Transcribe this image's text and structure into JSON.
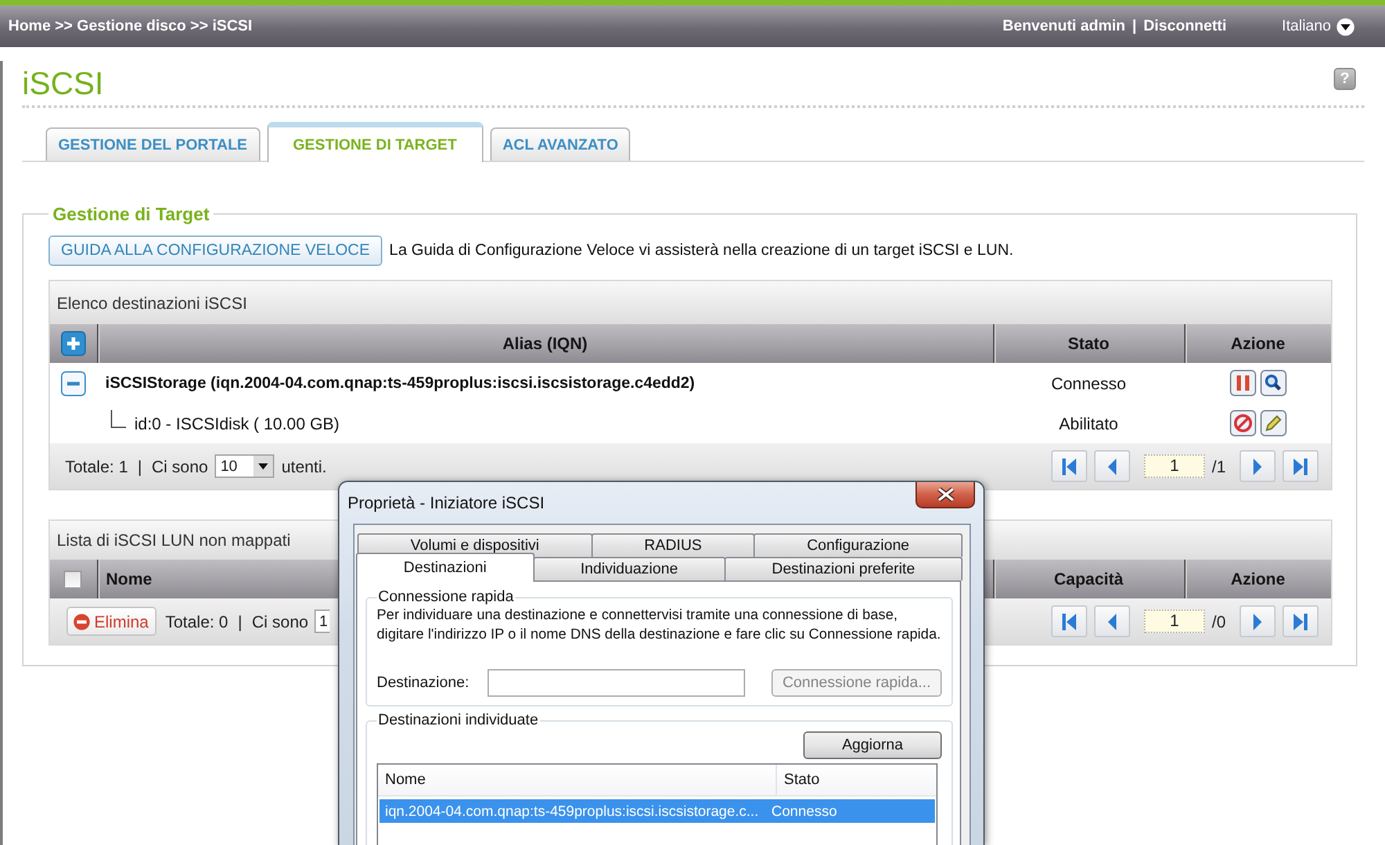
{
  "top_bar": {
    "breadcrumb": "Home >> Gestione disco >> iSCSI",
    "welcome": "Benvenuti admin",
    "separator": "|",
    "logout": "Disconnetti",
    "language": "Italiano"
  },
  "page": {
    "title": "iSCSI",
    "help": "?"
  },
  "tabs": [
    {
      "label": "GESTIONE DEL PORTALE",
      "selected": false
    },
    {
      "label": "GESTIONE DI TARGET",
      "selected": true
    },
    {
      "label": "ACL AVANZATO",
      "selected": false
    }
  ],
  "target_section": {
    "legend": "Gestione di Target",
    "wizard_button": "GUIDA ALLA CONFIGURAZIONE VELOCE",
    "wizard_hint": "La Guida di Configurazione Veloce vi assisterà nella creazione di un target iSCSI e LUN."
  },
  "targets_panel": {
    "title": "Elenco destinazioni iSCSI",
    "columns": [
      "Alias (IQN)",
      "Stato",
      "Azione"
    ],
    "rows": [
      {
        "kind": "target",
        "expanded": true,
        "alias": "iSCSIStorage (iqn.2004-04.com.qnap:ts-459proplus:iscsi.iscsistorage.c4edd2)",
        "status": "Connesso",
        "children": [
          {
            "kind": "lun",
            "alias": "id:0 - ISCSIdisk ( 10.00 GB)",
            "status": "Abilitato"
          }
        ]
      }
    ],
    "footer": {
      "total": "Totale: 1",
      "separator": "|",
      "per_page_label": "Ci sono",
      "per_page": "10",
      "per_page_suffix": "utenti.",
      "page": "1",
      "page_count": "/1"
    }
  },
  "unmapped_panel": {
    "title": "Lista di iSCSI LUN non mappati",
    "select_all": {
      "checked": false
    },
    "columns": [
      "Nome",
      "Capacità",
      "Azione"
    ],
    "footer": {
      "delete_button": "Elimina",
      "total": "Totale: 0",
      "separator": "|",
      "per_page_label": "Ci sono",
      "per_page": "1",
      "page": "1",
      "page_count": "/0"
    }
  },
  "dialog": {
    "title": "Proprietà - Iniziatore iSCSI",
    "tab_rows": [
      [
        {
          "label": "Volumi e dispositivi",
          "selected": false
        },
        {
          "label": "RADIUS",
          "selected": false
        },
        {
          "label": "Configurazione",
          "selected": false
        }
      ],
      [
        {
          "label": "Destinazioni",
          "selected": true
        },
        {
          "label": "Individuazione",
          "selected": false
        },
        {
          "label": "Destinazioni preferite",
          "selected": false
        }
      ]
    ],
    "quick_connect": {
      "legend": "Connessione rapida",
      "description": "Per individuare una destinazione e connettervisi tramite una connessione di base,\ndigitare l'indirizzo IP o il nome DNS della destinazione e fare clic su Connessione rapida.",
      "target_label": "Destinazione:",
      "connect_button": {
        "label": "Connessione rapida...",
        "disabled": true
      }
    },
    "discovered": {
      "legend": "Destinazioni individuate",
      "refresh_button": "Aggiorna",
      "columns": [
        "Nome",
        "Stato"
      ],
      "rows": [
        {
          "name": "iqn.2004-04.com.qnap:ts-459proplus:iscsi.iscsistorage.c...",
          "status": "Connesso",
          "selected": true
        }
      ]
    }
  }
}
